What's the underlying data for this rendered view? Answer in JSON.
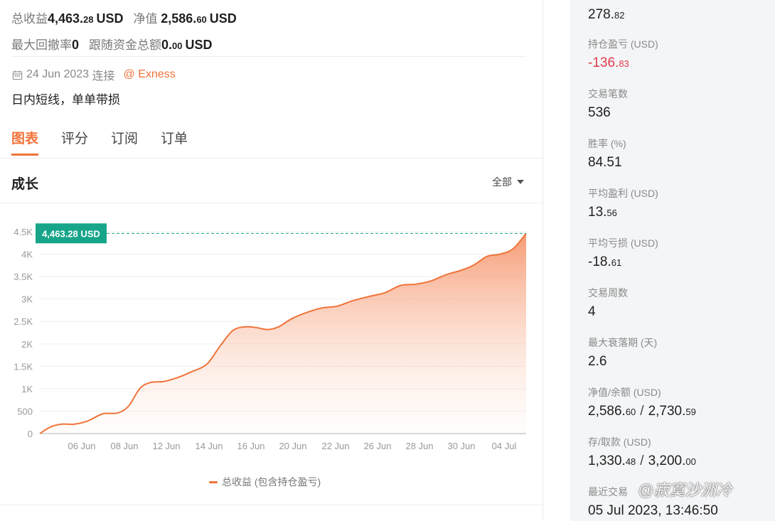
{
  "summary": {
    "total_profit_label": "总收益",
    "total_profit_int": "4,463.",
    "total_profit_dec": "28",
    "total_profit_unit": "USD",
    "equity_label": "净值",
    "equity_int": "2,586.",
    "equity_dec": "60",
    "equity_unit": "USD",
    "max_drawdown_label": "最大回撤率",
    "max_drawdown_value": "0",
    "follow_funds_label": "跟随资金总额",
    "follow_funds_int": "0.",
    "follow_funds_dec": "00",
    "follow_funds_unit": "USD"
  },
  "meta": {
    "date": "24 Jun 2023",
    "connect_label": "连接",
    "broker": "@ Exness",
    "description": "日内短线，单单带损"
  },
  "tabs": [
    {
      "label": "图表",
      "active": true
    },
    {
      "label": "评分",
      "active": false
    },
    {
      "label": "订阅",
      "active": false
    },
    {
      "label": "订单",
      "active": false
    }
  ],
  "growth": {
    "title": "成长",
    "filter_label": "全部",
    "tooltip": "4,463.28 USD",
    "legend": "总收益 (包含持仓盈亏)"
  },
  "chart_data": {
    "type": "area",
    "series": [
      {
        "name": "总收益 (包含持仓盈亏)",
        "color": "#f0733a"
      }
    ],
    "x_labels": [
      "06 Jun",
      "08 Jun",
      "12 Jun",
      "14 Jun",
      "16 Jun",
      "20 Jun",
      "22 Jun",
      "26 Jun",
      "28 Jun",
      "30 Jun",
      "04 Jul"
    ],
    "y_ticks": [
      0,
      500,
      1000,
      1500,
      2000,
      2500,
      3000,
      3500,
      4000,
      4500
    ],
    "y_tick_labels": [
      "0",
      "500",
      "1K",
      "1.5K",
      "2K",
      "2.5K",
      "3K",
      "3.5K",
      "4K",
      "4.5K"
    ],
    "ylim": [
      0,
      4500
    ],
    "grid": true,
    "points": [
      {
        "i": 0,
        "v": 0
      },
      {
        "i": 0.5,
        "v": 150
      },
      {
        "i": 1.0,
        "v": 210
      },
      {
        "i": 1.6,
        "v": 210
      },
      {
        "i": 2.2,
        "v": 280
      },
      {
        "i": 2.9,
        "v": 440
      },
      {
        "i": 3.6,
        "v": 460
      },
      {
        "i": 4.1,
        "v": 620
      },
      {
        "i": 4.6,
        "v": 1000
      },
      {
        "i": 5.1,
        "v": 1140
      },
      {
        "i": 5.7,
        "v": 1160
      },
      {
        "i": 6.3,
        "v": 1240
      },
      {
        "i": 7.0,
        "v": 1380
      },
      {
        "i": 7.7,
        "v": 1550
      },
      {
        "i": 8.3,
        "v": 1950
      },
      {
        "i": 8.9,
        "v": 2300
      },
      {
        "i": 9.5,
        "v": 2380
      },
      {
        "i": 10.0,
        "v": 2360
      },
      {
        "i": 10.5,
        "v": 2320
      },
      {
        "i": 11.0,
        "v": 2380
      },
      {
        "i": 11.6,
        "v": 2560
      },
      {
        "i": 12.3,
        "v": 2700
      },
      {
        "i": 13.0,
        "v": 2800
      },
      {
        "i": 13.7,
        "v": 2840
      },
      {
        "i": 14.4,
        "v": 2960
      },
      {
        "i": 15.2,
        "v": 3060
      },
      {
        "i": 15.9,
        "v": 3140
      },
      {
        "i": 16.6,
        "v": 3300
      },
      {
        "i": 17.3,
        "v": 3330
      },
      {
        "i": 18.0,
        "v": 3400
      },
      {
        "i": 18.7,
        "v": 3540
      },
      {
        "i": 19.4,
        "v": 3640
      },
      {
        "i": 20.0,
        "v": 3760
      },
      {
        "i": 20.6,
        "v": 3950
      },
      {
        "i": 21.2,
        "v": 4000
      },
      {
        "i": 21.8,
        "v": 4120
      },
      {
        "i": 22.4,
        "v": 4463.28
      }
    ],
    "max_value": 4463.28,
    "fill": "gradient"
  },
  "stats": [
    {
      "label": "",
      "int": "278.",
      "dec": "82",
      "negative": false
    },
    {
      "label": "持仓盈亏 (USD)",
      "int": "-136.",
      "dec": "83",
      "negative": true
    },
    {
      "label": "交易笔数",
      "int": "536",
      "dec": "",
      "negative": false
    },
    {
      "label": "胜率 (%)",
      "int": "84.51",
      "dec": "",
      "negative": false
    },
    {
      "label": "平均盈利 (USD)",
      "int": "13.",
      "dec": "56",
      "negative": false
    },
    {
      "label": "平均亏损 (USD)",
      "int": "-18.",
      "dec": "61",
      "negative": false
    },
    {
      "label": "交易周数",
      "int": "4",
      "dec": "",
      "negative": false
    },
    {
      "label": "最大衰落期 (天)",
      "int": "2.6",
      "dec": "",
      "negative": false
    }
  ],
  "equity_balance": {
    "label": "净值/余额 (USD)",
    "a_int": "2,586.",
    "a_dec": "60",
    "sep": "/",
    "b_int": "2,730.",
    "b_dec": "59"
  },
  "deposit_withdraw": {
    "label": "存/取款 (USD)",
    "a_int": "1,330.",
    "a_dec": "48",
    "sep": "/",
    "b_int": "3,200.",
    "b_dec": "00"
  },
  "last_trade": {
    "label": "最近交易",
    "value": "05 Jul 2023, 13:46:50"
  },
  "watermark": "@寂寞沙洲冷"
}
